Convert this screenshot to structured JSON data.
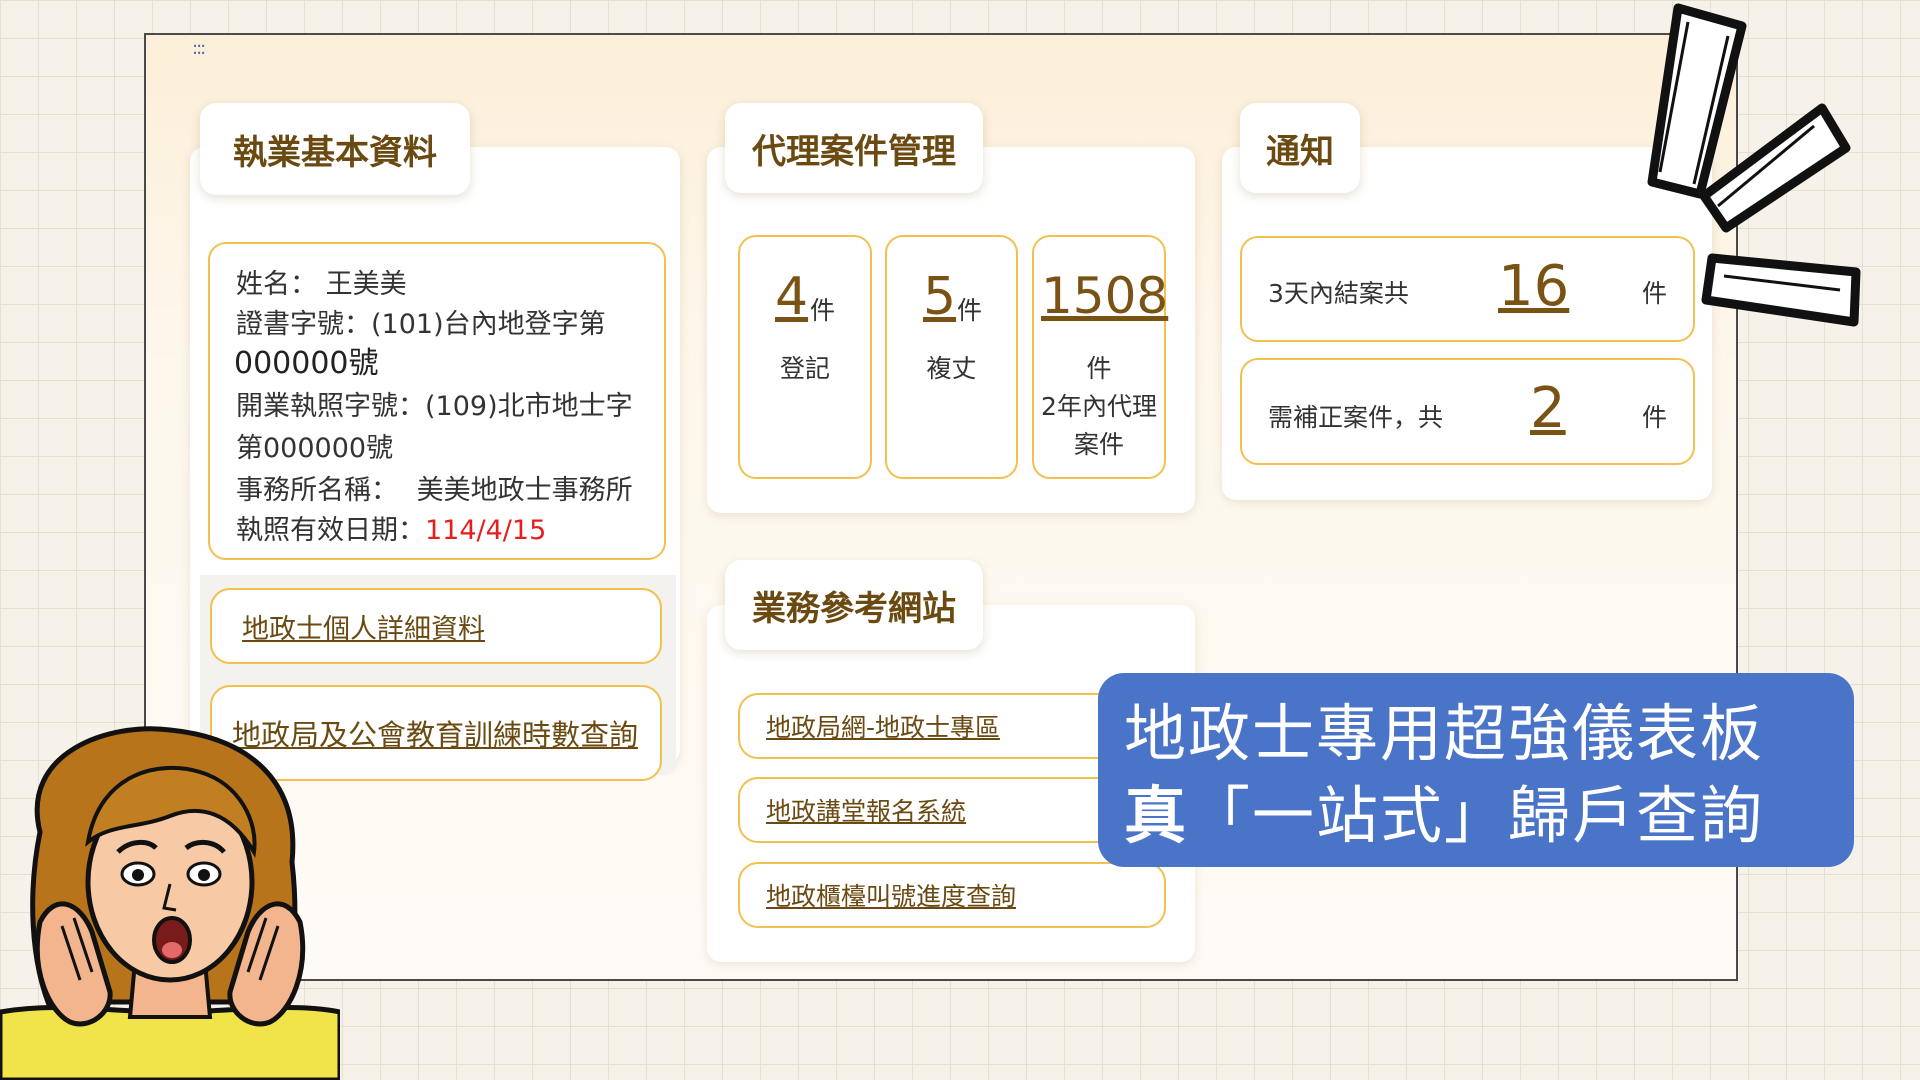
{
  "menu_icon": "menu-dots-icon",
  "basic_info": {
    "tab": "執業基本資料",
    "name_label": "姓名：",
    "name_value": "王美美",
    "cert_label": "證書字號：",
    "cert_value_1": "(101)台內地登字第",
    "cert_value_2": "000000號",
    "license_label": "開業執照字號：",
    "license_value_1": "(109)北市地士字",
    "license_value_2": "第000000號",
    "office_label": "事務所名稱：",
    "office_value": "美美地政士事務所",
    "expiry_label": "執照有效日期：",
    "expiry_value": "114/4/15",
    "link_detail": "地政士個人詳細資料",
    "link_training": "地政局及公會教育訓練時數查詢"
  },
  "cases": {
    "tab": "代理案件管理",
    "items": [
      {
        "number": "4",
        "unit": "件",
        "label": "登記"
      },
      {
        "number": "5",
        "unit": "件",
        "label": "複丈"
      },
      {
        "number": "1508",
        "unit": "件",
        "label_1": "2年內代理",
        "label_2": "案件"
      }
    ]
  },
  "notify": {
    "tab": "通知",
    "row1": {
      "label": "3天內結案共",
      "number": "16",
      "unit": "件"
    },
    "row2": {
      "label": "需補正案件，共",
      "number": "2",
      "unit": "件"
    }
  },
  "reference": {
    "tab": "業務參考網站",
    "links": [
      "地政局網-地政士專區",
      "地政講堂報名系統",
      "地政櫃檯叫號進度查詢"
    ]
  },
  "banner": {
    "line1": "地政士專用超強儀表板",
    "line2_bold": "真",
    "line2_rest": "「一站式」歸戶查詢"
  },
  "colors": {
    "accent_border": "#f2c04f",
    "link_brown": "#6b4a12",
    "banner_blue": "#4a74c8",
    "date_red": "#e61e1e"
  }
}
